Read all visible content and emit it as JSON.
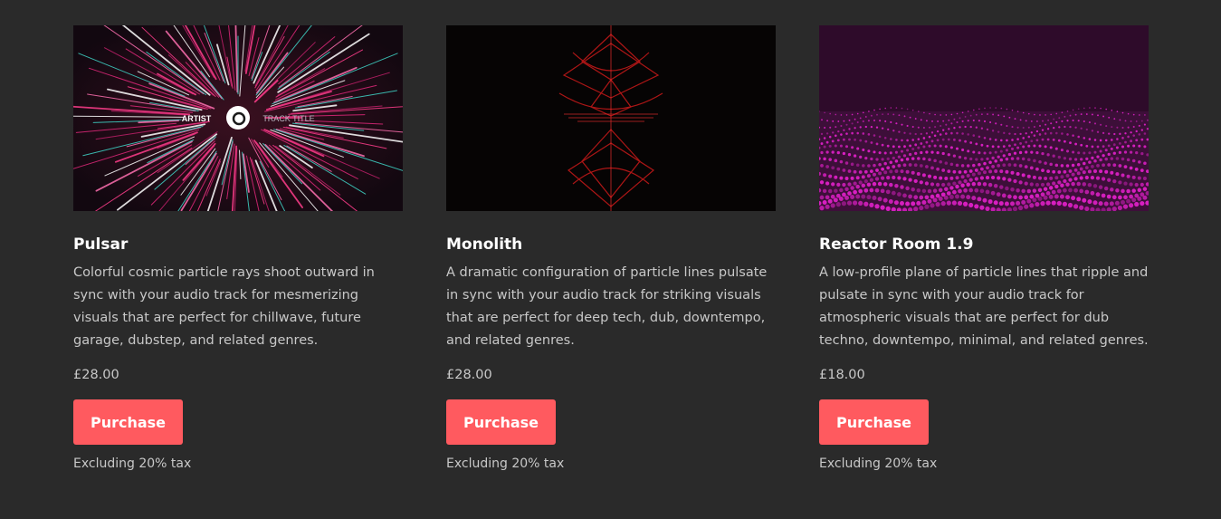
{
  "products": [
    {
      "title": "Pulsar",
      "description": "Colorful cosmic particle rays shoot outward in sync with your audio track for mesmerizing visuals that are perfect for chillwave, future garage, dubstep, and related genres.",
      "price": "£28.00",
      "button_label": "Purchase",
      "tax_note": "Excluding 20% tax",
      "thumb_artist": "ARTIST",
      "thumb_track": "TRACK TITLE"
    },
    {
      "title": "Monolith",
      "description": "A dramatic configuration of particle lines pulsate in sync with your audio track for striking visuals that are perfect for deep tech, dub, downtempo, and related genres.",
      "price": "£28.00",
      "button_label": "Purchase",
      "tax_note": "Excluding 20% tax"
    },
    {
      "title": "Reactor Room 1.9",
      "description": "A low-profile plane of particle lines that ripple and pulsate in sync with your audio track for atmospheric visuals that are perfect for dub techno, downtempo, minimal, and related genres.",
      "price": "£18.00",
      "button_label": "Purchase",
      "tax_note": "Excluding 20% tax"
    }
  ],
  "colors": {
    "background": "#2a2a2a",
    "button": "#ff5a5f",
    "title": "#ffffff",
    "body_text": "#c8c8c8"
  }
}
